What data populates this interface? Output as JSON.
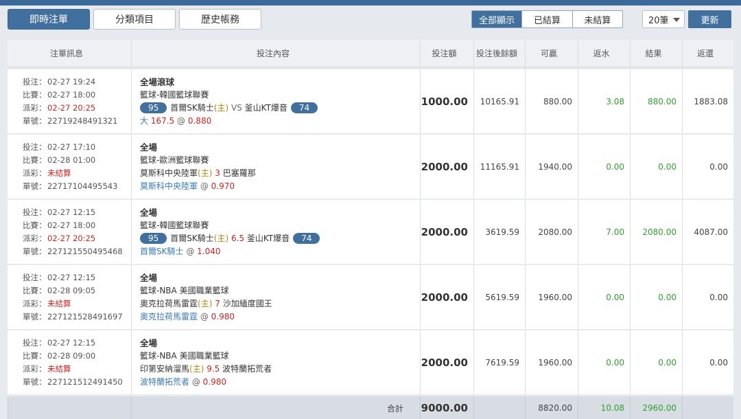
{
  "tabs": [
    {
      "label": "即時注單",
      "active": true
    },
    {
      "label": "分類項目",
      "active": false
    },
    {
      "label": "歷史帳務",
      "active": false
    }
  ],
  "filters": [
    {
      "label": "全部顯示",
      "active": true
    },
    {
      "label": "已結算",
      "active": false
    },
    {
      "label": "未結算",
      "active": false
    }
  ],
  "count_select": "20筆",
  "refresh_label": "更新",
  "headers": [
    "注單訊息",
    "投注內容",
    "投注額",
    "投注後餘額",
    "可贏",
    "返水",
    "結果",
    "返還"
  ],
  "info_labels": {
    "bet": "投注：",
    "match": "比賽：",
    "settle": "派彩：",
    "no": "單號："
  },
  "bets": [
    {
      "bet_time": "02-27 19:24",
      "match_time": "02-27 18:00",
      "settle": "02-27 20:25",
      "order_no": "22719248491321",
      "title": "全場滾球",
      "league": "籃球-韓國籃球聯賽",
      "score_home": "95",
      "team_home": "首爾SK騎士",
      "home_tag": "(主)",
      "handicap": "",
      "vs": "VS",
      "team_away": "釜山KT爆音",
      "score_away": "74",
      "pick": "大",
      "pick_line": "167.5",
      "at": "@",
      "odds": "0.880",
      "stake": "1000.00",
      "balance": "10165.91",
      "win": "880.00",
      "rebate": "3.08",
      "result": "880.00",
      "return": "1883.08"
    },
    {
      "bet_time": "02-27 17:10",
      "match_time": "02-28 01:00",
      "settle": "未結算",
      "order_no": "22717104495543",
      "title": "全場",
      "league": "籃球-歐洲籃球聯賽",
      "score_home": "",
      "team_home": "莫斯科中央陸軍",
      "home_tag": "(主)",
      "handicap": "3",
      "vs": "",
      "team_away": "巴塞羅那",
      "score_away": "",
      "pick": "莫斯科中央陸軍",
      "pick_line": "",
      "at": "@",
      "odds": "0.970",
      "stake": "2000.00",
      "balance": "11165.91",
      "win": "1940.00",
      "rebate": "0.00",
      "result": "0.00",
      "return": "0.00"
    },
    {
      "bet_time": "02-27 12:15",
      "match_time": "02-27 18:00",
      "settle": "02-27 20:25",
      "order_no": "227121550495468",
      "title": "全場",
      "league": "籃球-韓國籃球聯賽",
      "score_home": "95",
      "team_home": "首爾SK騎士",
      "home_tag": "(主)",
      "handicap": "6.5",
      "vs": "",
      "team_away": "釜山KT爆音",
      "score_away": "74",
      "pick": "首爾SK騎士",
      "pick_line": "",
      "at": "@",
      "odds": "1.040",
      "stake": "2000.00",
      "balance": "3619.59",
      "win": "2080.00",
      "rebate": "7.00",
      "result": "2080.00",
      "return": "4087.00"
    },
    {
      "bet_time": "02-27 12:15",
      "match_time": "02-28 09:05",
      "settle": "未結算",
      "order_no": "227121528491697",
      "title": "全場",
      "league": "籃球-NBA 美國職業籃球",
      "score_home": "",
      "team_home": "奧克拉荷馬雷霆",
      "home_tag": "(主)",
      "handicap": "7",
      "vs": "",
      "team_away": "沙加緬度國王",
      "score_away": "",
      "pick": "奧克拉荷馬雷霆",
      "pick_line": "",
      "at": "@",
      "odds": "0.980",
      "stake": "2000.00",
      "balance": "5619.59",
      "win": "1960.00",
      "rebate": "0.00",
      "result": "0.00",
      "return": "0.00"
    },
    {
      "bet_time": "02-27 12:15",
      "match_time": "02-28 09:00",
      "settle": "未結算",
      "order_no": "227121512491450",
      "title": "全場",
      "league": "籃球-NBA 美國職業籃球",
      "score_home": "",
      "team_home": "印第安納溜馬",
      "home_tag": "(主)",
      "handicap": "9.5",
      "vs": "",
      "team_away": "波特蘭拓荒者",
      "score_away": "",
      "pick": "波特蘭拓荒者",
      "pick_line": "",
      "at": "@",
      "odds": "0.980",
      "stake": "2000.00",
      "balance": "7619.59",
      "win": "1960.00",
      "rebate": "0.00",
      "result": "0.00",
      "return": "0.00"
    }
  ],
  "totals": {
    "label": "合計",
    "stake": "9000.00",
    "balance": "",
    "win": "8820.00",
    "rebate": "10.08",
    "result": "2960.00",
    "return": ""
  },
  "colors": {
    "accent": "#41709f",
    "settled_red": "#cc2222",
    "positive_green": "#2ea02e",
    "pick_blue": "#3878b8"
  }
}
